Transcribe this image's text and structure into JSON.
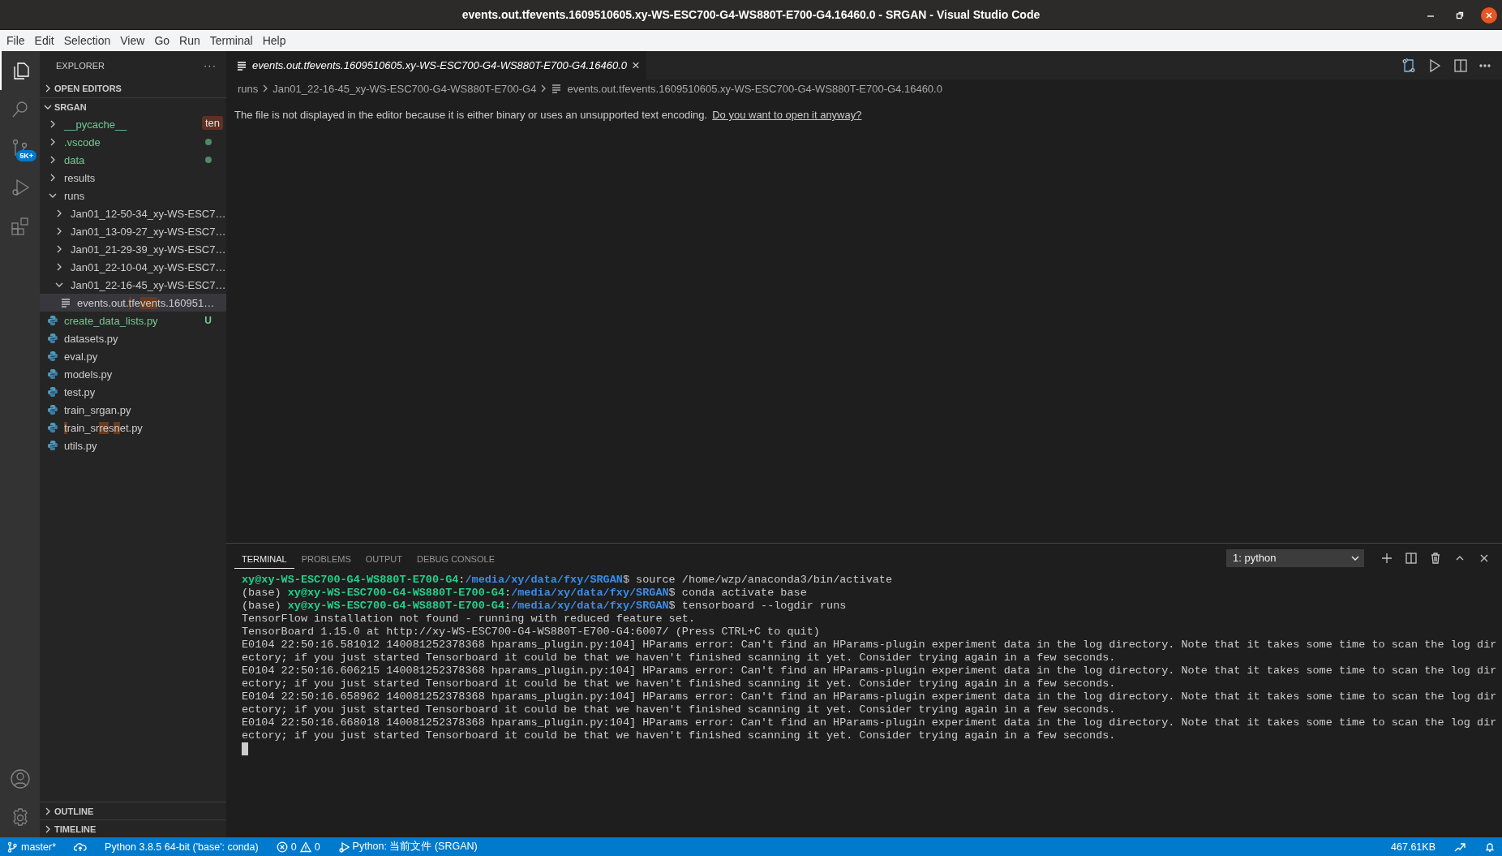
{
  "window": {
    "title": "events.out.tfevents.1609510605.xy-WS-ESC700-G4-WS880T-E700-G4.16460.0 - SRGAN - Visual Studio Code"
  },
  "menu": [
    "File",
    "Edit",
    "Selection",
    "View",
    "Go",
    "Run",
    "Terminal",
    "Help"
  ],
  "activity_bar": {
    "items": [
      {
        "kind": "explorer",
        "selected": true
      },
      {
        "kind": "search",
        "selected": false
      },
      {
        "kind": "source-control",
        "selected": false,
        "badge": "5K+"
      },
      {
        "kind": "run",
        "selected": false
      },
      {
        "kind": "extensions",
        "selected": false
      }
    ],
    "bottom": [
      {
        "kind": "account"
      },
      {
        "kind": "settings"
      }
    ]
  },
  "sidebar": {
    "title": "EXPLORER",
    "more": "···",
    "sections_top": [
      {
        "label": "OPEN EDITORS",
        "expanded": false
      }
    ],
    "folder": {
      "label": "SRGAN",
      "expanded": true,
      "tree": [
        {
          "kind": "folder",
          "label": "__pycache__",
          "expanded": false,
          "selected": false,
          "color": "#73c991",
          "tooltip": "ten"
        },
        {
          "kind": "folder",
          "label": ".vscode",
          "expanded": false,
          "selected": false,
          "color": "#73c991",
          "dot": true
        },
        {
          "kind": "folder",
          "label": "data",
          "expanded": false,
          "selected": false,
          "color": "#73c991",
          "dot": true
        },
        {
          "kind": "folder",
          "label": "results",
          "expanded": false,
          "selected": false,
          "color": "#cccccc"
        },
        {
          "kind": "folder",
          "label": "runs",
          "expanded": true,
          "selected": false,
          "color": "#cccccc",
          "children": [
            {
              "kind": "folder",
              "label": "Jan01_12-50-34_xy-WS-ESC7…",
              "expanded": false,
              "selected": false,
              "color": "#cccccc"
            },
            {
              "kind": "folder",
              "label": "Jan01_13-09-27_xy-WS-ESC7…",
              "expanded": false,
              "selected": false,
              "color": "#cccccc"
            },
            {
              "kind": "folder",
              "label": "Jan01_21-29-39_xy-WS-ESC7…",
              "expanded": false,
              "selected": false,
              "color": "#cccccc"
            },
            {
              "kind": "folder",
              "label": "Jan01_22-10-04_xy-WS-ESC7…",
              "expanded": false,
              "selected": false,
              "color": "#cccccc"
            },
            {
              "kind": "folder",
              "label": "Jan01_22-16-45_xy-WS-ESC7…",
              "expanded": true,
              "selected": false,
              "color": "#cccccc",
              "children": [
                {
                  "kind": "text",
                  "selected": true,
                  "color": "#cccccc",
                  "segments": [
                    {
                      "text": "events.out.",
                      "match": false
                    },
                    {
                      "text": "t",
                      "match": true
                    },
                    {
                      "text": "fe",
                      "match": false
                    },
                    {
                      "text": "ven",
                      "match": true
                    },
                    {
                      "text": "ts.160951…",
                      "match": false
                    }
                  ]
                }
              ]
            }
          ]
        },
        {
          "kind": "python",
          "label": "create_data_lists.py",
          "selected": false,
          "color": "#73c991",
          "badge": "U"
        },
        {
          "kind": "python",
          "label": "datasets.py",
          "selected": false,
          "color": "#cccccc"
        },
        {
          "kind": "python",
          "label": "eval.py",
          "selected": false,
          "color": "#cccccc"
        },
        {
          "kind": "python",
          "label": "models.py",
          "selected": false,
          "color": "#cccccc"
        },
        {
          "kind": "python",
          "label": "test.py",
          "selected": false,
          "color": "#cccccc"
        },
        {
          "kind": "python",
          "label": "train_srgan.py",
          "selected": false,
          "color": "#cccccc"
        },
        {
          "kind": "python",
          "selected": false,
          "color": "#cccccc",
          "segments": [
            {
              "text": "t",
              "match": true
            },
            {
              "text": "rain_sr",
              "match": false
            },
            {
              "text": "re",
              "match": true
            },
            {
              "text": "s",
              "match": false
            },
            {
              "text": "n",
              "match": true
            },
            {
              "text": "et.py",
              "match": false
            }
          ]
        },
        {
          "kind": "python",
          "label": "utils.py",
          "selected": false,
          "color": "#cccccc"
        }
      ]
    },
    "sections_bottom": [
      {
        "label": "OUTLINE",
        "expanded": false
      },
      {
        "label": "TIMELINE",
        "expanded": false
      }
    ]
  },
  "editor": {
    "tab": {
      "label": "events.out.tfevents.1609510605.xy-WS-ESC700-G4-WS880T-E700-G4.16460.0",
      "preview": true,
      "close": "×"
    },
    "breadcrumbs": [
      "runs",
      "Jan01_22-16-45_xy-WS-ESC700-G4-WS880T-E700-G4",
      "events.out.tfevents.1609510605.xy-WS-ESC700-G4-WS880T-E700-G4.16460.0"
    ],
    "message": "The file is not displayed in the editor because it is either binary or uses an unsupported text encoding.",
    "link": "Do you want to open it anyway?"
  },
  "panel": {
    "tabs": [
      {
        "label": "TERMINAL",
        "selected": true
      },
      {
        "label": "PROBLEMS",
        "selected": false
      },
      {
        "label": "OUTPUT",
        "selected": false
      },
      {
        "label": "DEBUG CONSOLE",
        "selected": false
      }
    ],
    "terminal_select": "1: python",
    "lines": [
      {
        "kind": "prompt",
        "user": "xy@xy-WS-ESC700-G4-WS880T-E700-G4",
        "sep": ":",
        "path": "/media/xy/data/fxy/SRGAN",
        "command": "$ source /home/wzp/anaconda3/bin/activate"
      },
      {
        "kind": "prompt",
        "prefix": "(base) ",
        "user": "xy@xy-WS-ESC700-G4-WS880T-E700-G4",
        "sep": ":",
        "path": "/media/xy/data/fxy/SRGAN",
        "command": "$ conda activate base"
      },
      {
        "kind": "prompt",
        "prefix": "(base) ",
        "user": "xy@xy-WS-ESC700-G4-WS880T-E700-G4",
        "sep": ":",
        "path": "/media/xy/data/fxy/SRGAN",
        "command": "$ tensorboard --logdir runs"
      },
      {
        "kind": "output",
        "text": "TensorFlow installation not found - running with reduced feature set."
      },
      {
        "kind": "output",
        "text": "TensorBoard 1.15.0 at http://xy-WS-ESC700-G4-WS880T-E700-G4:6007/ (Press CTRL+C to quit)"
      },
      {
        "kind": "output",
        "text": "E0104 22:50:16.581012 140081252378368 hparams_plugin.py:104] HParams error: Can't find an HParams-plugin experiment data in the log directory. Note that it takes some time to scan the log dir"
      },
      {
        "kind": "output",
        "text": "ectory; if you just started Tensorboard it could be that we haven't finished scanning it yet. Consider trying again in a few seconds."
      },
      {
        "kind": "output",
        "text": "E0104 22:50:16.606215 140081252378368 hparams_plugin.py:104] HParams error: Can't find an HParams-plugin experiment data in the log directory. Note that it takes some time to scan the log dir"
      },
      {
        "kind": "output",
        "text": "ectory; if you just started Tensorboard it could be that we haven't finished scanning it yet. Consider trying again in a few seconds."
      },
      {
        "kind": "output",
        "text": "E0104 22:50:16.658962 140081252378368 hparams_plugin.py:104] HParams error: Can't find an HParams-plugin experiment data in the log directory. Note that it takes some time to scan the log dir"
      },
      {
        "kind": "output",
        "text": "ectory; if you just started Tensorboard it could be that we haven't finished scanning it yet. Consider trying again in a few seconds."
      },
      {
        "kind": "output",
        "text": "E0104 22:50:16.668018 140081252378368 hparams_plugin.py:104] HParams error: Can't find an HParams-plugin experiment data in the log directory. Note that it takes some time to scan the log dir"
      },
      {
        "kind": "output",
        "text": "ectory; if you just started Tensorboard it could be that we haven't finished scanning it yet. Consider trying again in a few seconds."
      },
      {
        "kind": "cursor"
      }
    ]
  },
  "status_bar": {
    "left": [
      {
        "kind": "branch",
        "text": "master*"
      },
      {
        "kind": "sync"
      },
      {
        "kind": "text",
        "text": "Python 3.8.5 64-bit ('base': conda)"
      },
      {
        "kind": "problems",
        "errors": "0",
        "warnings": "0"
      },
      {
        "kind": "debug",
        "text": "Python: 当前文件 (SRGAN)"
      }
    ],
    "right": [
      {
        "kind": "text",
        "text": "467.61KB"
      },
      {
        "kind": "feedback"
      },
      {
        "kind": "bell"
      }
    ]
  }
}
